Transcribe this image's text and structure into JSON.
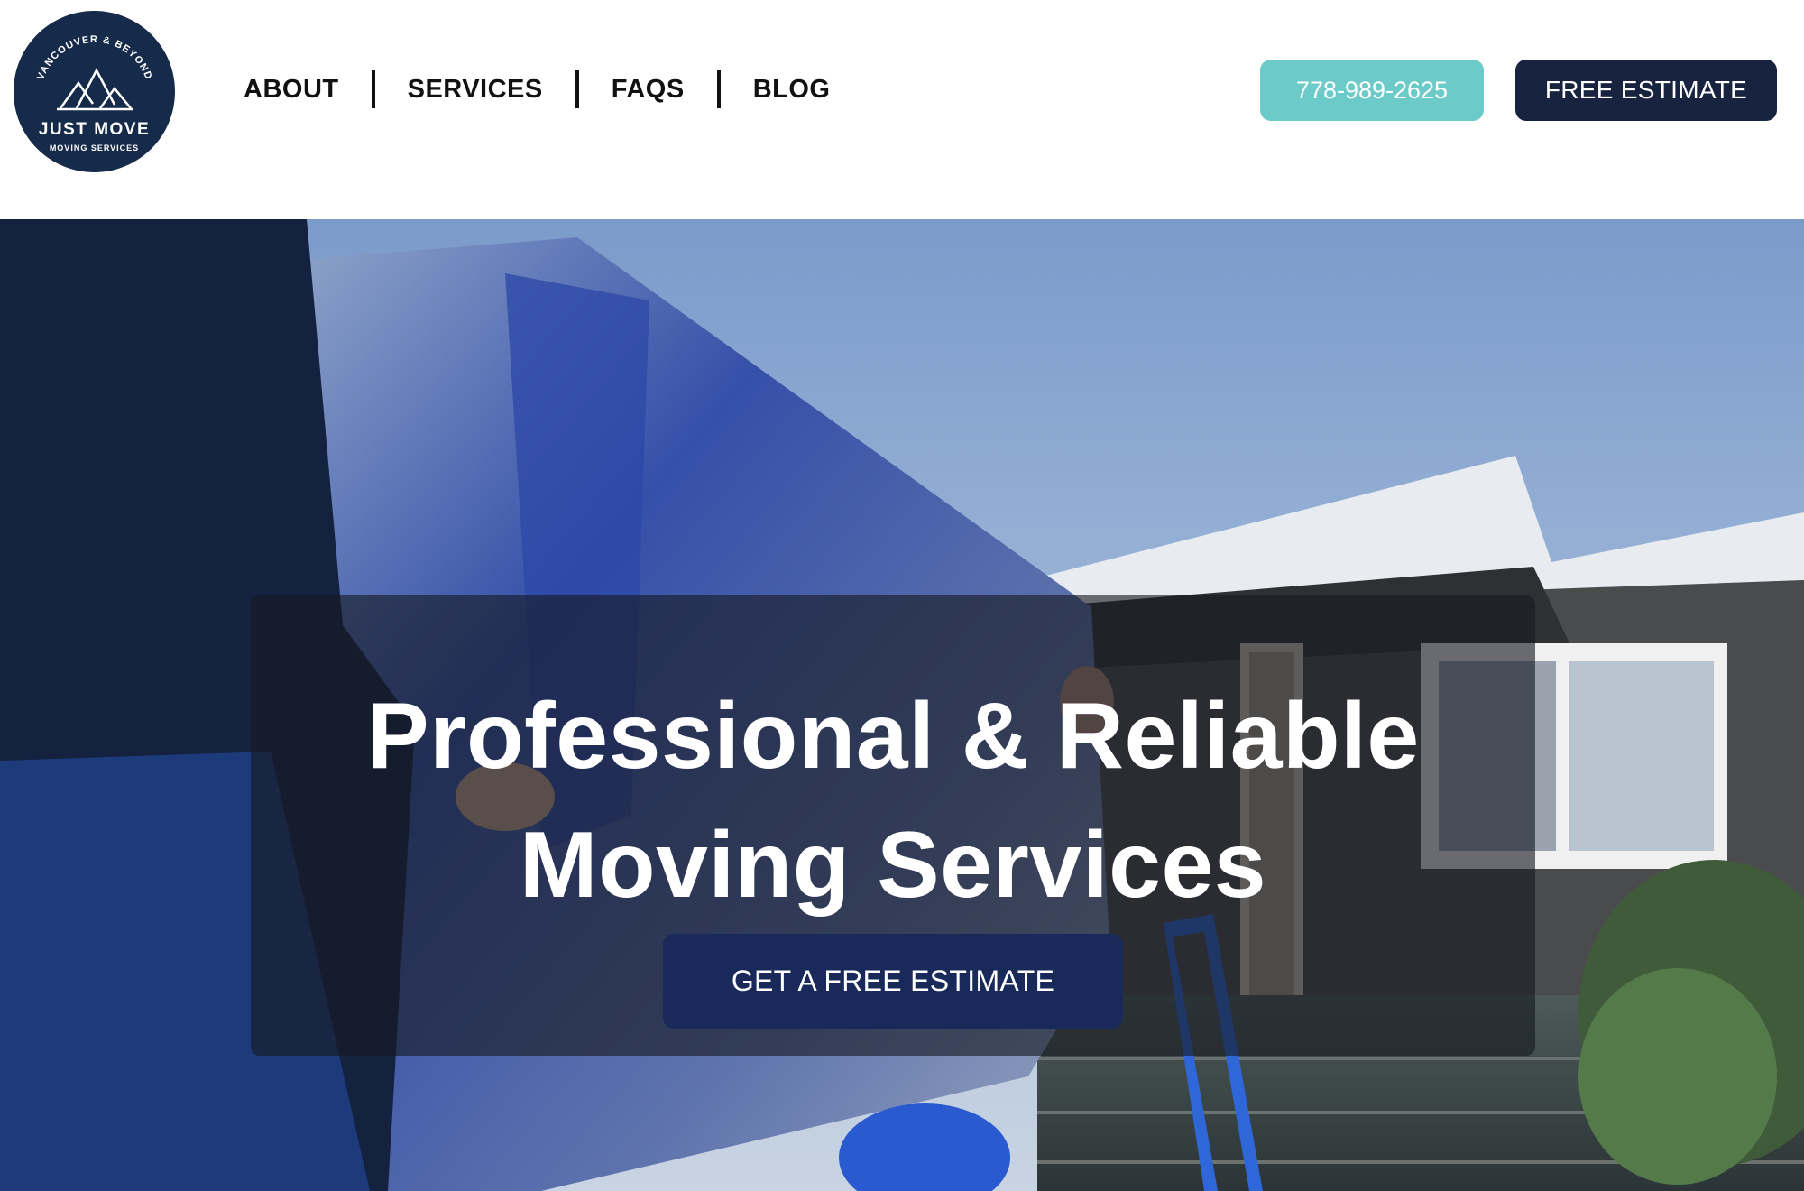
{
  "logo": {
    "arc_text": "VANCOUVER & BEYOND",
    "name": "JUST MOVE",
    "tagline": "MOVING SERVICES"
  },
  "nav": {
    "items": [
      {
        "label": "ABOUT"
      },
      {
        "label": "SERVICES"
      },
      {
        "label": "FAQS"
      },
      {
        "label": "BLOG"
      }
    ]
  },
  "header_buttons": {
    "phone": "778-989-2625",
    "estimate": "FREE ESTIMATE"
  },
  "hero": {
    "title_line_1": "Professional & Reliable",
    "title_line_2": "Moving Services",
    "cta_label": "GET A FREE ESTIMATE"
  },
  "colors": {
    "brand_navy": "#18233f",
    "cta_navy": "#18295a",
    "phone_teal": "#6ccbc8",
    "logo_navy": "#162a4a"
  }
}
